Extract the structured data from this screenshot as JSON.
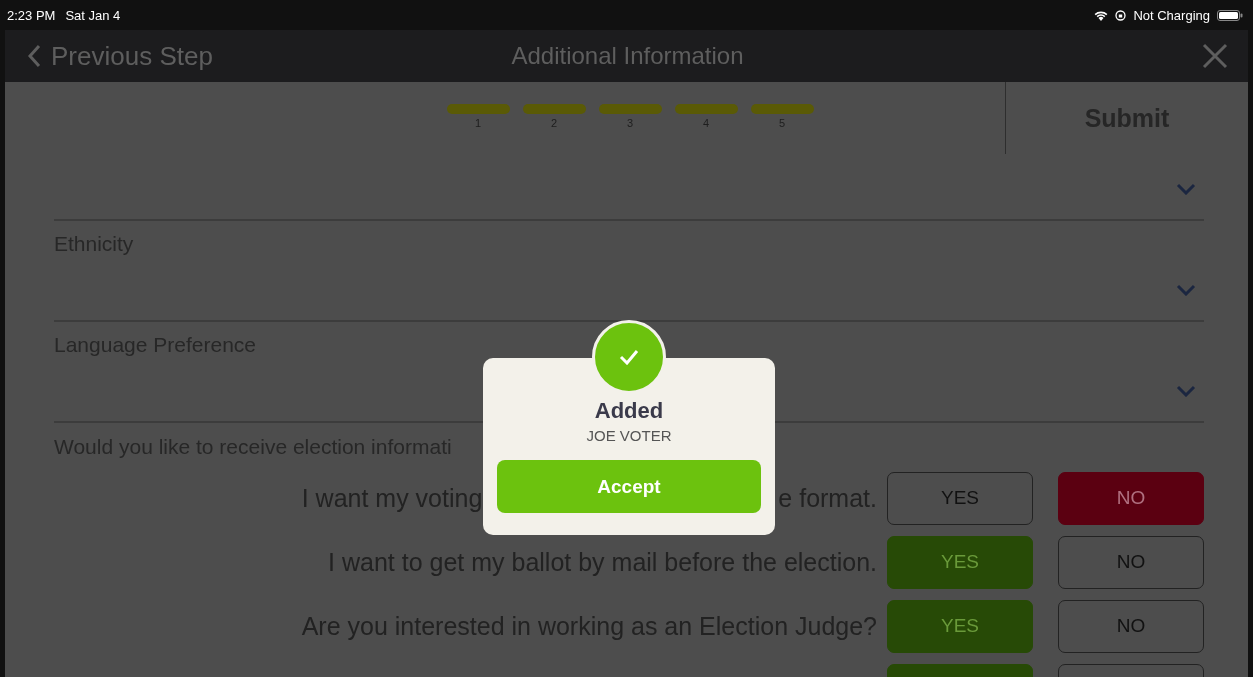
{
  "status_bar": {
    "time": "2:23 PM",
    "date": "Sat Jan 4",
    "charging": "Not Charging"
  },
  "nav": {
    "back": "Previous Step",
    "title": "Additional Information"
  },
  "steps": [
    {
      "label": "1",
      "completed": true
    },
    {
      "label": "2",
      "completed": true
    },
    {
      "label": "3",
      "completed": true
    },
    {
      "label": "4",
      "completed": true
    },
    {
      "label": "5",
      "completed": true
    }
  ],
  "submit": "Submit",
  "dropdowns": [
    {
      "kind": "unlabeled"
    },
    {
      "kind": "labeled",
      "label": "Ethnicity"
    },
    {
      "kind": "labeled",
      "label": "Language Preference"
    }
  ],
  "question_heading": "Would you like to receive election informati",
  "questions": [
    {
      "question_parts": [
        "I want my voting",
        "e format."
      ],
      "buttons": [
        {
          "kind": "yes",
          "label": "YES",
          "selected": false
        },
        {
          "kind": "no",
          "label": "NO",
          "selected": true
        }
      ]
    },
    {
      "question_parts": [
        "I want to get my ballot by mail before the election."
      ],
      "buttons": [
        {
          "kind": "yes",
          "label": "YES",
          "selected": true
        },
        {
          "kind": "no",
          "label": "NO",
          "selected": false
        }
      ]
    },
    {
      "question_parts": [
        "Are you interested in working as an Election Judge?"
      ],
      "buttons": [
        {
          "kind": "yes",
          "label": "YES",
          "selected": true
        },
        {
          "kind": "no",
          "label": "NO",
          "selected": false
        }
      ]
    },
    {
      "buttons": [
        {
          "kind": "yes",
          "selected": true
        },
        {
          "kind": "no",
          "selected": false
        }
      ]
    }
  ],
  "dialog": {
    "title": "Added",
    "name": "JOE VOTER",
    "button": "Accept"
  }
}
